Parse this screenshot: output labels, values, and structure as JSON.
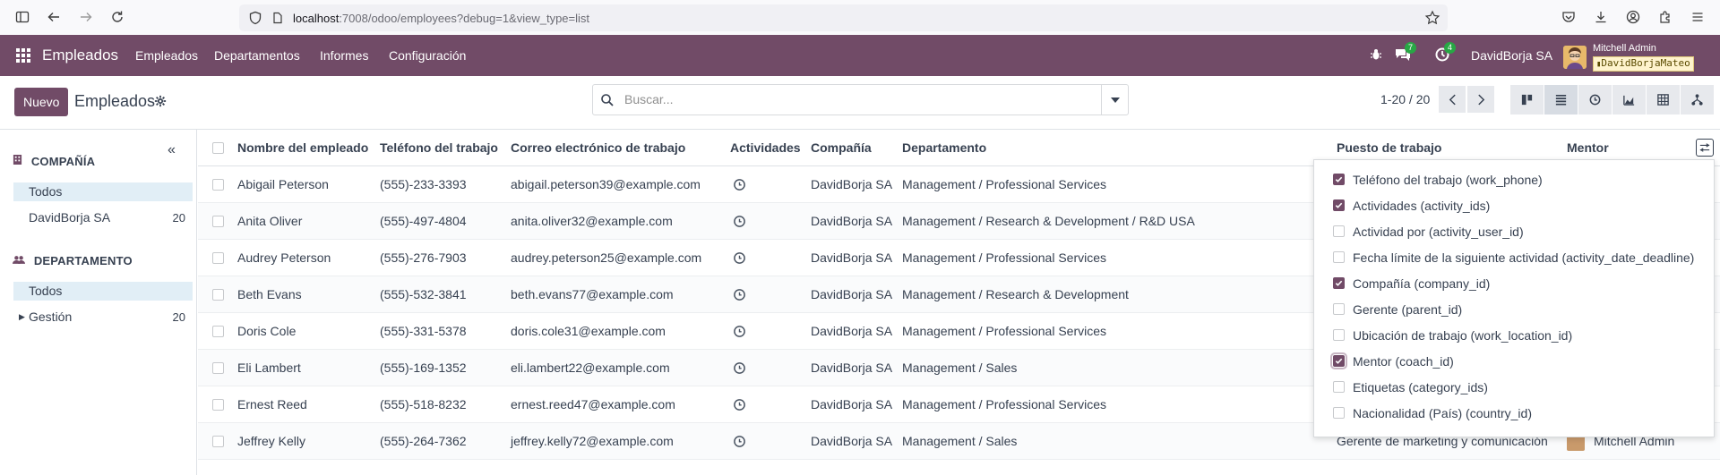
{
  "browser": {
    "url_host": "localhost",
    "url_rest": ":7008/odoo/employees?debug=1&view_type=list"
  },
  "navbar": {
    "app_name": "Empleados",
    "menu": [
      "Empleados",
      "Departamentos",
      "Informes",
      "Configuración"
    ],
    "messages_count": "7",
    "activities_count": "4",
    "company": "DavidBorja SA",
    "user_name": "Mitchell Admin",
    "user_db": "DavidBorjaMateo"
  },
  "control_panel": {
    "new_button": "Nuevo",
    "title": "Empleados",
    "search_placeholder": "Buscar...",
    "pager": "1-20 / 20"
  },
  "side_panel": {
    "company_header": "COMPAÑÍA",
    "company_items": [
      {
        "label": "Todos",
        "count": ""
      },
      {
        "label": "DavidBorja SA",
        "count": "20"
      }
    ],
    "department_header": "DEPARTAMENTO",
    "department_items": [
      {
        "label": "Todos",
        "count": ""
      },
      {
        "label": "Gestión",
        "count": "20"
      }
    ]
  },
  "list": {
    "headers": {
      "name": "Nombre del empleado",
      "phone": "Teléfono del trabajo",
      "email": "Correo electrónico de trabajo",
      "activities": "Actividades",
      "company": "Compañía",
      "department": "Departamento",
      "job": "Puesto de trabajo",
      "mentor": "Mentor"
    },
    "rows": [
      {
        "name": "Abigail Peterson",
        "phone": "(555)-233-3393",
        "email": "abigail.peterson39@example.com",
        "company": "DavidBorja SA",
        "department": "Management / Professional Services",
        "job": "",
        "mentor": ""
      },
      {
        "name": "Anita Oliver",
        "phone": "(555)-497-4804",
        "email": "anita.oliver32@example.com",
        "company": "DavidBorja SA",
        "department": "Management / Research & Development / R&D USA",
        "job": "",
        "mentor": ""
      },
      {
        "name": "Audrey Peterson",
        "phone": "(555)-276-7903",
        "email": "audrey.peterson25@example.com",
        "company": "DavidBorja SA",
        "department": "Management / Professional Services",
        "job": "",
        "mentor": ""
      },
      {
        "name": "Beth Evans",
        "phone": "(555)-532-3841",
        "email": "beth.evans77@example.com",
        "company": "DavidBorja SA",
        "department": "Management / Research & Development",
        "job": "",
        "mentor": ""
      },
      {
        "name": "Doris Cole",
        "phone": "(555)-331-5378",
        "email": "doris.cole31@example.com",
        "company": "DavidBorja SA",
        "department": "Management / Professional Services",
        "job": "",
        "mentor": ""
      },
      {
        "name": "Eli Lambert",
        "phone": "(555)-169-1352",
        "email": "eli.lambert22@example.com",
        "company": "DavidBorja SA",
        "department": "Management / Sales",
        "job": "",
        "mentor": ""
      },
      {
        "name": "Ernest Reed",
        "phone": "(555)-518-8232",
        "email": "ernest.reed47@example.com",
        "company": "DavidBorja SA",
        "department": "Management / Professional Services",
        "job": "",
        "mentor": ""
      },
      {
        "name": "Jeffrey Kelly",
        "phone": "(555)-264-7362",
        "email": "jeffrey.kelly72@example.com",
        "company": "DavidBorja SA",
        "department": "Management / Sales",
        "job": "Gerente de marketing y comunicación",
        "mentor": "Mitchell Admin"
      }
    ]
  },
  "optional_columns": [
    {
      "label": "Teléfono del trabajo (work_phone)",
      "checked": true
    },
    {
      "label": "Actividades (activity_ids)",
      "checked": true
    },
    {
      "label": "Actividad por (activity_user_id)",
      "checked": false
    },
    {
      "label": "Fecha límite de la siguiente actividad (activity_date_deadline)",
      "checked": false
    },
    {
      "label": "Compañía (company_id)",
      "checked": true
    },
    {
      "label": "Gerente (parent_id)",
      "checked": false
    },
    {
      "label": "Ubicación de trabajo (work_location_id)",
      "checked": false
    },
    {
      "label": "Mentor (coach_id)",
      "checked": true
    },
    {
      "label": "Etiquetas (category_ids)",
      "checked": false
    },
    {
      "label": "Nacionalidad (País) (country_id)",
      "checked": false
    }
  ],
  "colors": {
    "brand": "#714b67",
    "badge": "#28a745",
    "selected_bg": "#e1eef6"
  }
}
